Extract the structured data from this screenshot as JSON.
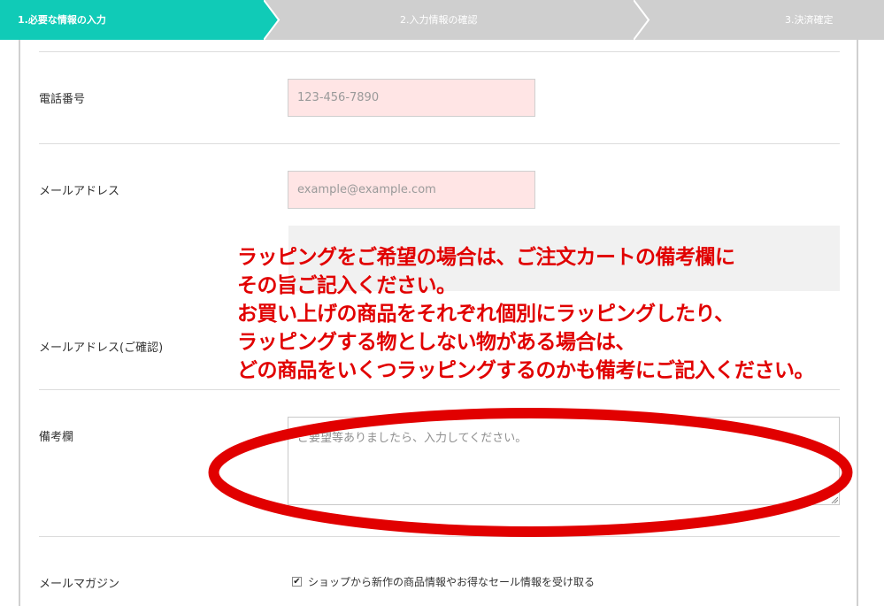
{
  "stepper": {
    "step1": "1.必要な情報の入力",
    "step2": "2.入力情報の確認",
    "step3": "3.決済確定"
  },
  "form": {
    "phone": {
      "label": "電話番号",
      "placeholder": "123-456-7890"
    },
    "email": {
      "label": "メールアドレス",
      "placeholder": "example@example.com"
    },
    "email_confirm": {
      "label": "メールアドレス(ご確認)"
    },
    "notes": {
      "label": "備考欄",
      "placeholder": "ご要望等ありましたら、入力してください。"
    },
    "magazine": {
      "label": "メールマガジン",
      "checkbox_label": "ショップから新作の商品情報やお得なセール情報を受け取る",
      "checked": true
    }
  },
  "annotation": {
    "lines": [
      "ラッピングをご希望の場合は、ご注文カートの備考欄に",
      "その旨ご記入ください。",
      "お買い上げの商品をそれぞれ個別にラッピングしたり、",
      "ラッピングする物としない物がある場合は、",
      "どの商品をいくつラッピングするのかも備考にご記入ください。"
    ]
  },
  "colors": {
    "accent": "#10cbb7",
    "stepper_inactive": "#cfcfcf",
    "required_field_bg": "#ffe5e5",
    "annotation": "#e10000"
  }
}
